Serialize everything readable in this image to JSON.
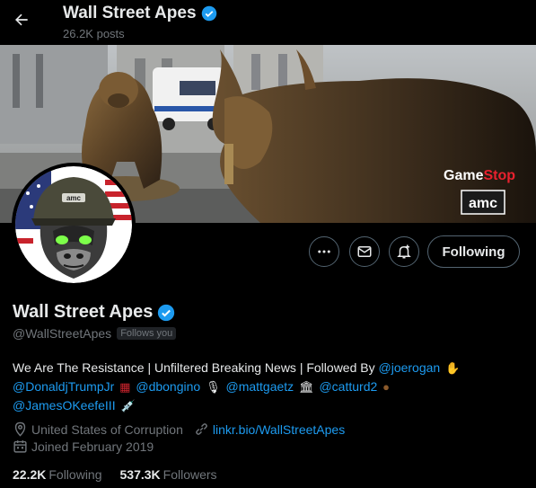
{
  "header": {
    "title": "Wall Street Apes",
    "posts": "26.2K posts"
  },
  "banner": {
    "logo_game": "Game",
    "logo_stop": "Stop",
    "logo_amc": "amc"
  },
  "avatar": {
    "text": "amc"
  },
  "actions": {
    "following_label": "Following"
  },
  "profile": {
    "name": "Wall Street Apes",
    "handle": "@WallStreetApes",
    "follows_you": "Follows you",
    "bio_line1": "We Are The Resistance | Unfiltered Breaking News | Followed By ",
    "mention_joerogan": "@joerogan",
    "mention_djt": "@DonaldjTrumpJr",
    "mention_dbongino": "@dbongino",
    "mention_mattgaetz": "@mattgaetz",
    "mention_catturd2": "@catturd2",
    "mention_james": "@JamesOKeefeIII",
    "location": "United States of Corruption",
    "website": "linkr.bio/WallStreetApes",
    "joined": "Joined February 2019"
  },
  "stats": {
    "following_count": "22.2K",
    "following_label": "Following",
    "followers_count": "537.3K",
    "followers_label": "Followers"
  },
  "colors": {
    "accent": "#1d9bf0",
    "muted": "#71767b",
    "text": "#e7e9ea",
    "background": "#000000"
  }
}
